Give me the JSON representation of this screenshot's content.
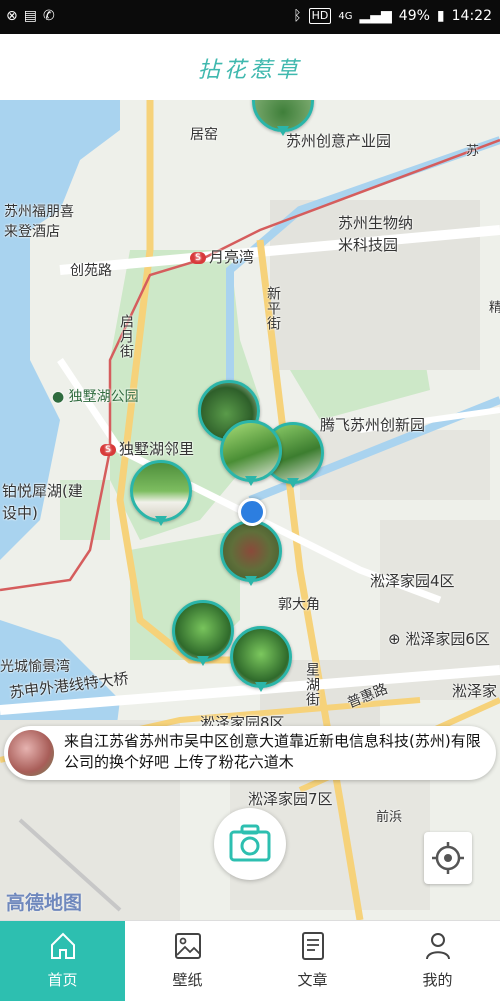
{
  "status_bar": {
    "hd": "HD",
    "network": "4G",
    "battery": "49%",
    "time": "14:22"
  },
  "app": {
    "title": "拈花惹草"
  },
  "map": {
    "labels": {
      "juyuan": "居窑",
      "creative_park": "苏州创意产业园",
      "fupeng": "苏州福朋喜\n来登酒店",
      "bio_nano": "苏州生物纳\n米科技园",
      "yueliangwan": "月亮湾",
      "chuangyuan_road": "创苑路",
      "qiyue_street": "启月街",
      "xinping_street": "新平街",
      "dushuhu_park": "独墅湖公园",
      "tengfei": "腾飞苏州创新园",
      "dushuhu_linli": "独墅湖邻里",
      "boyue": "铂悦犀湖(建\n设中)",
      "songze_4": "淞泽家园4区",
      "guoda_jiao": "郭大角",
      "songze_6": "淞泽家园6区",
      "guangcheng": "光城愉景湾",
      "sushen_bridge": "苏申外港线特大桥",
      "xinghu_street": "星湖街",
      "puhui_road": "普惠路",
      "songze_jia": "淞泽家",
      "songze_8": "淞泽家园8区",
      "songze_7": "淞泽家园7区",
      "qianbin": "前浜",
      "su_marker": "苏",
      "jing_marker": "精"
    },
    "watermark": "高德地图"
  },
  "notice": {
    "text": "来自江苏省苏州市吴中区创意大道靠近新电信息科技(苏州)有限公司的换个好吧 上传了粉花六道木"
  },
  "tabs": [
    {
      "label": "首页",
      "icon": "home-icon",
      "active": true
    },
    {
      "label": "壁纸",
      "icon": "image-icon",
      "active": false
    },
    {
      "label": "文章",
      "icon": "article-icon",
      "active": false
    },
    {
      "label": "我的",
      "icon": "profile-icon",
      "active": false
    }
  ],
  "colors": {
    "accent": "#2dbfb0",
    "title": "#3fb8ae",
    "location_dot": "#2c7ee0"
  }
}
